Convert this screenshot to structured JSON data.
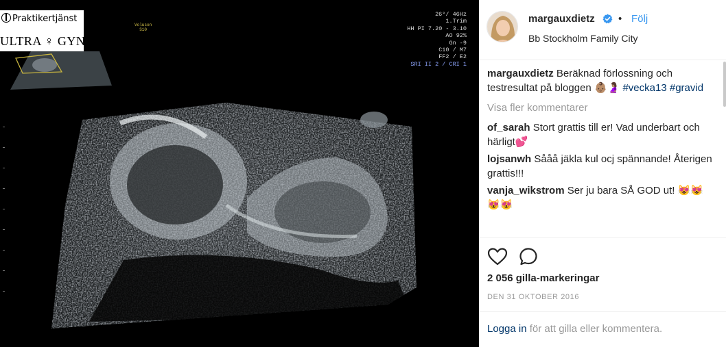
{
  "ultrasound": {
    "logo_top": "Praktikertjänst",
    "logo_bottom": "ULTRA ♀ GYN",
    "params": [
      "26°/ 46Hz",
      "1.Trim",
      "HH PI 7.20 - 3.10",
      "AO 92%",
      "Gn  -9",
      "C10 / M7",
      "FF2 / E2",
      "SRI II 2 / CRI 1"
    ],
    "small_label_1": "Voluson",
    "small_label_2": "S10"
  },
  "post": {
    "username": "margauxdietz",
    "verified": true,
    "follow_label": "Följ",
    "location": "Bb Stockholm Family City"
  },
  "caption": {
    "user": "margauxdietz",
    "text": "Beräknad förlossning och testresultat på bloggen 👶🏽🤰🏽",
    "tag1": "#vecka13",
    "tag2": "#gravid"
  },
  "view_more_label": "Visa fler kommentarer",
  "comments": [
    {
      "user": "of_sarah",
      "text": "Stort grattis till er! Vad underbart och härligt💕"
    },
    {
      "user": "lojsanwh",
      "text": "Sååå jäkla kul ocj spännande! Återigen grattis!!!"
    },
    {
      "user": "vanja_wikstrom",
      "text": "Ser ju bara SÅ GOD ut! 😻😻😻😻"
    }
  ],
  "likes_label": "2 056 gilla-markeringar",
  "date_label": "DEN 31 OKTOBER 2016",
  "login": {
    "link_label": "Logga in",
    "rest_label": " för att gilla eller kommentera."
  },
  "icons": {
    "like": "heart-icon",
    "comment": "comment-icon",
    "verified": "verified-badge-icon"
  },
  "colors": {
    "link_blue": "#3897f0",
    "hashtag": "#003569",
    "muted": "#999999",
    "verified": "#3897f0"
  }
}
